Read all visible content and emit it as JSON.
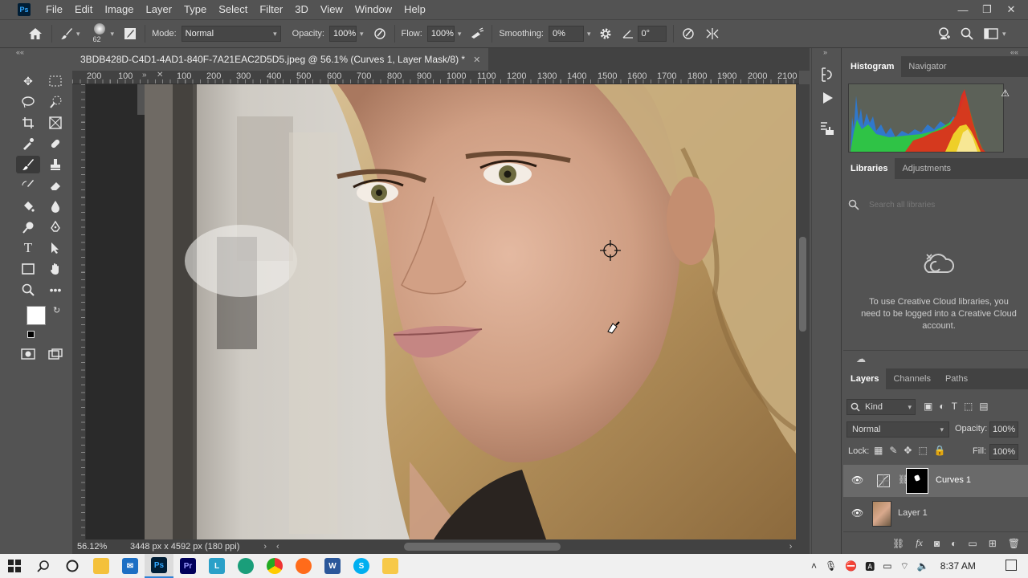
{
  "app": {
    "logo": "Ps"
  },
  "menu": [
    "File",
    "Edit",
    "Image",
    "Layer",
    "Type",
    "Select",
    "Filter",
    "3D",
    "View",
    "Window",
    "Help"
  ],
  "window_controls": {
    "minimize": "—",
    "restore": "❐",
    "close": "✕"
  },
  "options": {
    "brush_size": "62",
    "mode_label": "Mode:",
    "mode_value": "Normal",
    "opacity_label": "Opacity:",
    "opacity_value": "100%",
    "flow_label": "Flow:",
    "flow_value": "100%",
    "smoothing_label": "Smoothing:",
    "smoothing_value": "0%",
    "angle_value": "0°"
  },
  "document": {
    "tab_title": "3BDB428D-C4D1-4AD1-840F-7A21EAC2D5D5.jpeg @ 56.1% (Curves 1, Layer Mask/8) *",
    "close": "✕"
  },
  "ruler": {
    "labels": [
      "200",
      "100",
      "100",
      "200",
      "300",
      "400",
      "500",
      "600",
      "700",
      "800",
      "900",
      "1000",
      "1100",
      "1200",
      "1300",
      "1400",
      "1500",
      "1600",
      "1700",
      "1800",
      "1900",
      "2000",
      "2100"
    ]
  },
  "status": {
    "zoom": "56.12%",
    "doc_info": "3448 px x 4592 px (180 ppi)"
  },
  "panels": {
    "top_tabs": [
      "Histogram",
      "Navigator"
    ],
    "mid_tabs": [
      "Libraries",
      "Adjustments"
    ],
    "search_placeholder": "Search all libraries",
    "cc_message": "To use Creative Cloud libraries, you need to be logged into a Creative Cloud account.",
    "layer_tabs": [
      "Layers",
      "Channels",
      "Paths"
    ],
    "kind_label": "Kind",
    "blend_mode": "Normal",
    "opacity_label": "Opacity:",
    "opacity_value": "100%",
    "lock_label": "Lock:",
    "fill_label": "Fill:",
    "fill_value": "100%"
  },
  "layers": [
    {
      "name": "Curves 1",
      "selected": true
    },
    {
      "name": "Layer 1",
      "selected": false
    }
  ],
  "taskbar": {
    "apps": [
      "Pr",
      "L",
      "W",
      "S"
    ],
    "time": "8:37 AM"
  },
  "colors": {
    "accent": "#31a8ff",
    "panel_bg": "#535353",
    "dark_bg": "#424242"
  }
}
